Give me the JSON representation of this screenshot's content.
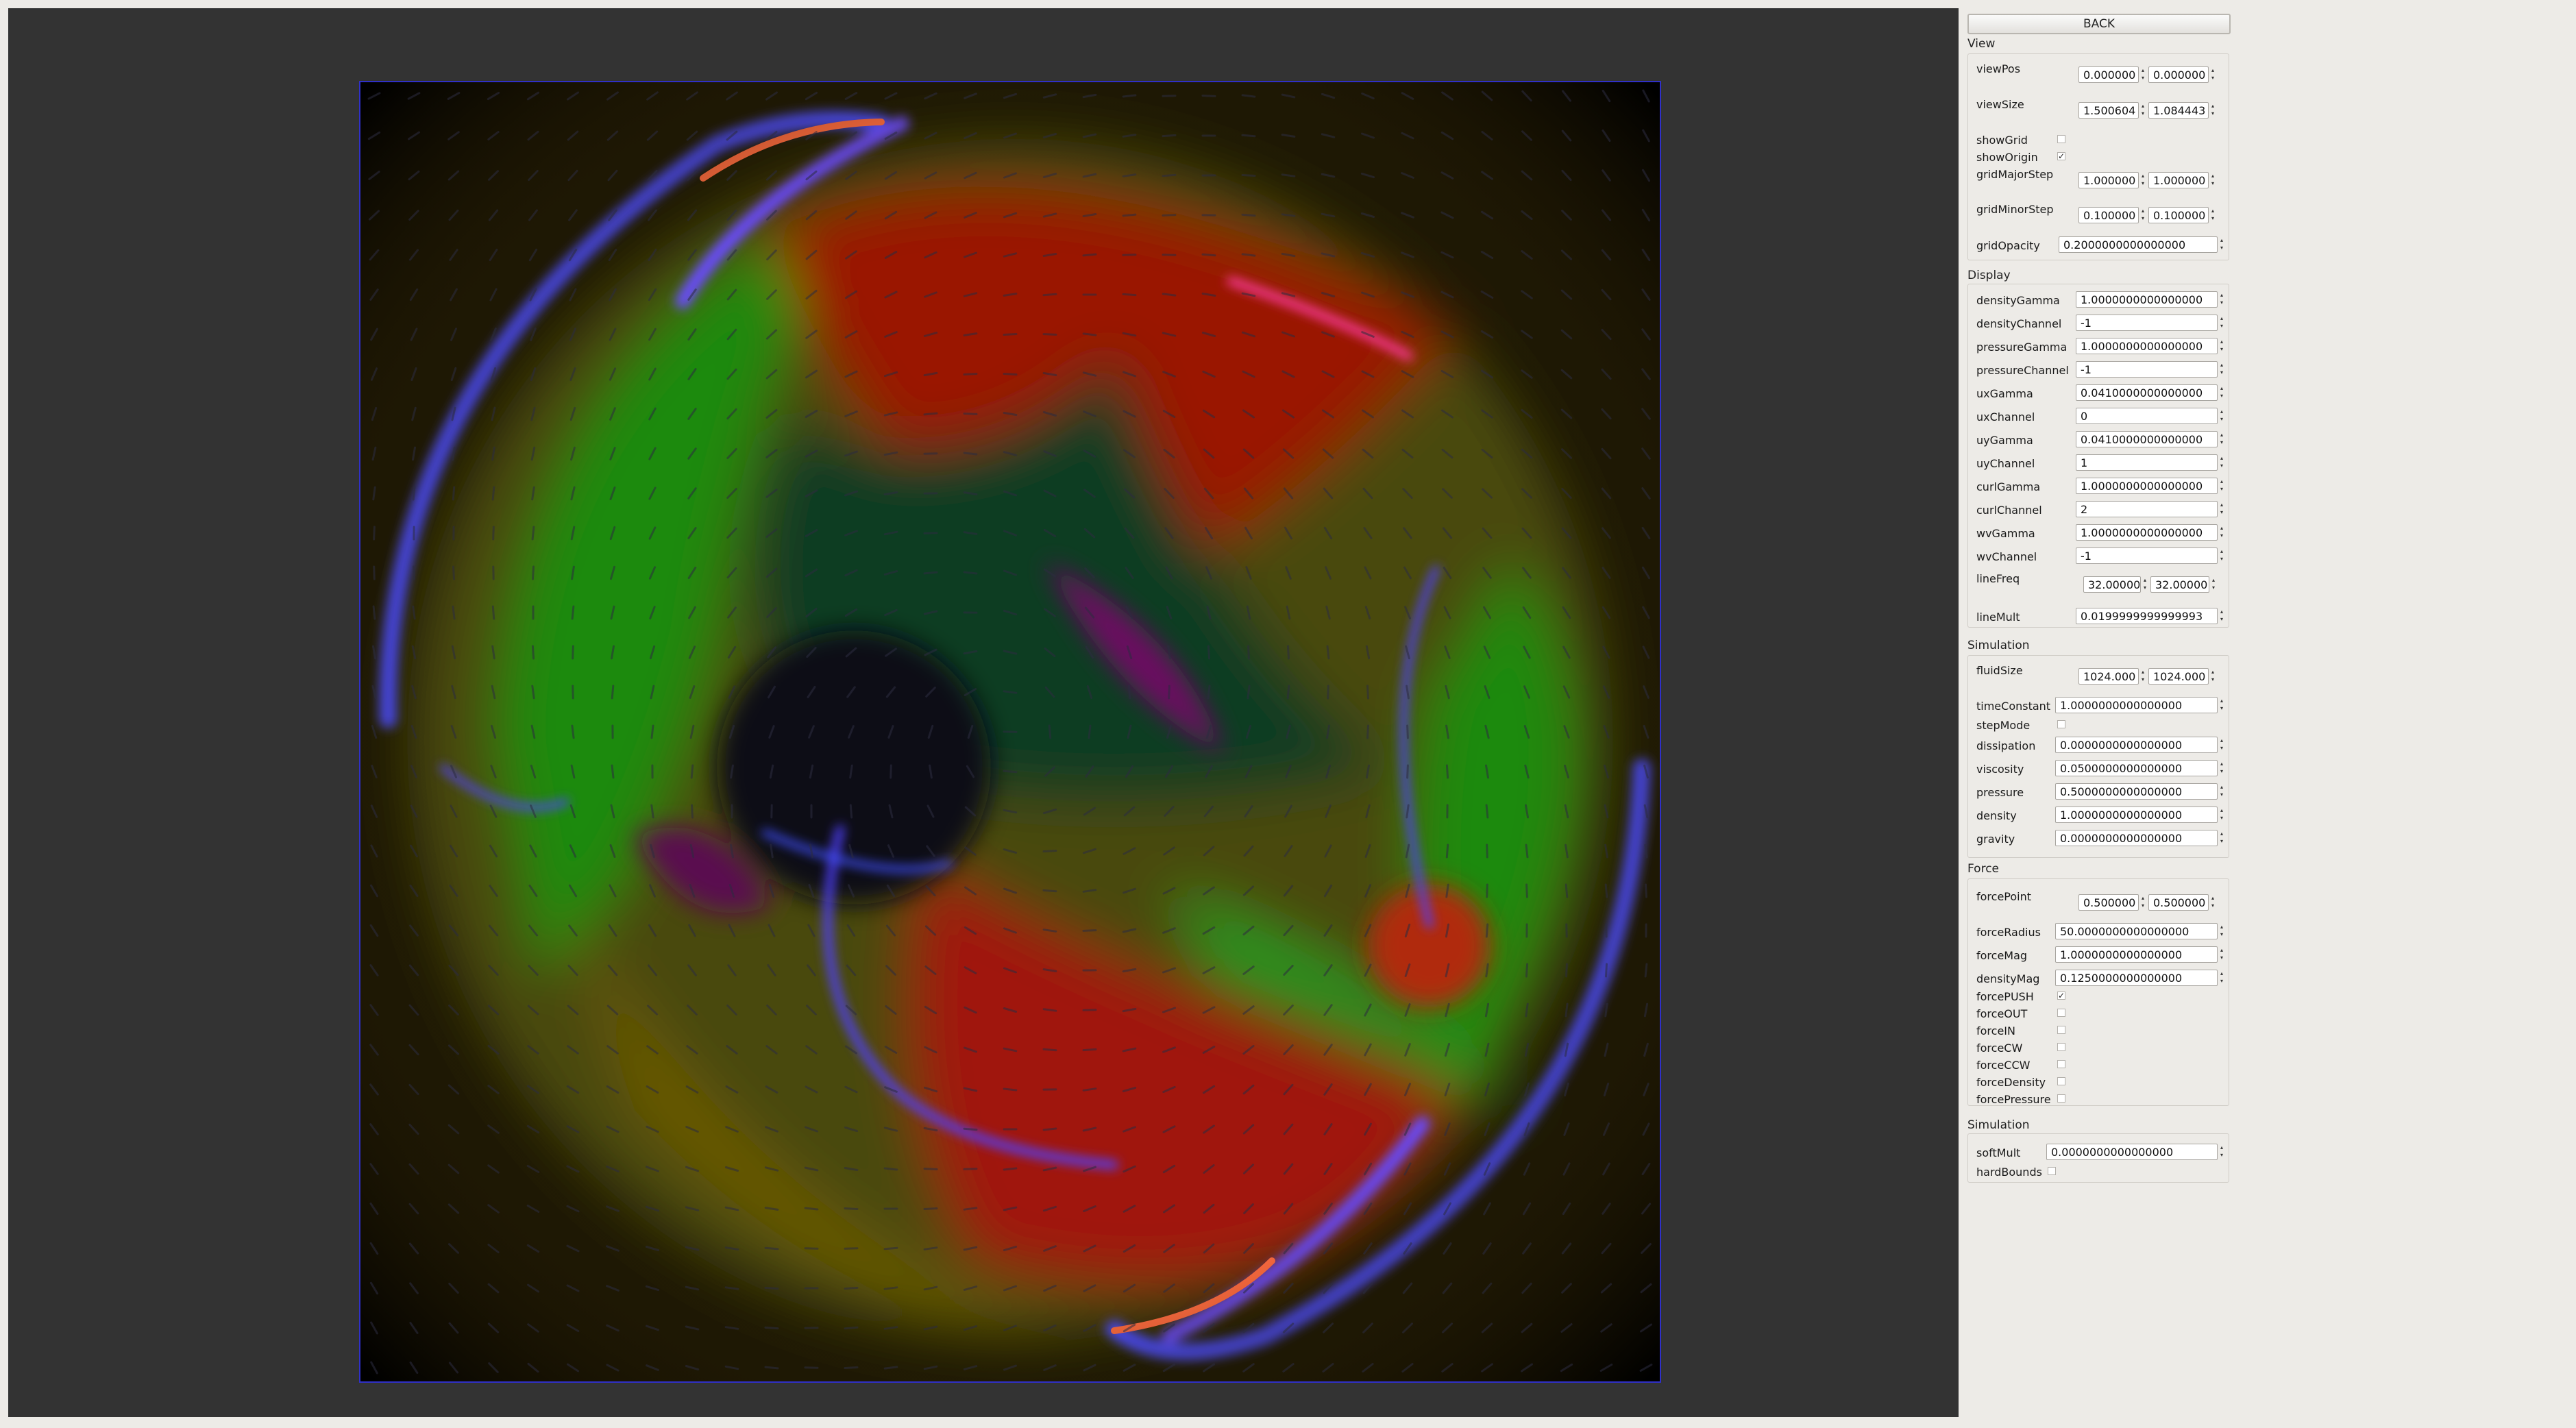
{
  "panel": {
    "back_label": "BACK",
    "sections": {
      "view": "View",
      "display": "Display",
      "simulation": "Simulation",
      "force": "Force",
      "simulation2": "Simulation"
    },
    "view": {
      "viewPos": {
        "label": "viewPos",
        "x": "0.000000",
        "y": "0.000000"
      },
      "viewSize": {
        "label": "viewSize",
        "x": "1.500604",
        "y": "1.084443"
      },
      "showGrid": {
        "label": "showGrid",
        "checked": false
      },
      "showOrigin": {
        "label": "showOrigin",
        "checked": true
      },
      "gridMajorStep": {
        "label": "gridMajorStep",
        "x": "1.000000",
        "y": "1.000000"
      },
      "gridMinorStep": {
        "label": "gridMinorStep",
        "x": "0.100000",
        "y": "0.100000"
      },
      "gridOpacity": {
        "label": "gridOpacity",
        "value": "0.2000000000000000"
      }
    },
    "display": [
      {
        "label": "densityGamma",
        "value": "1.0000000000000000"
      },
      {
        "label": "densityChannel",
        "value": "-1"
      },
      {
        "label": "pressureGamma",
        "value": "1.0000000000000000"
      },
      {
        "label": "pressureChannel",
        "value": "-1"
      },
      {
        "label": "uxGamma",
        "value": "0.0410000000000000"
      },
      {
        "label": "uxChannel",
        "value": "0"
      },
      {
        "label": "uyGamma",
        "value": "0.0410000000000000"
      },
      {
        "label": "uyChannel",
        "value": "1"
      },
      {
        "label": "curlGamma",
        "value": "1.0000000000000000"
      },
      {
        "label": "curlChannel",
        "value": "2"
      },
      {
        "label": "wvGamma",
        "value": "1.0000000000000000"
      },
      {
        "label": "wvChannel",
        "value": "-1"
      }
    ],
    "lineFreq": {
      "label": "lineFreq",
      "x": "32.00000",
      "y": "32.00000"
    },
    "lineMult": {
      "label": "lineMult",
      "value": "0.0199999999999993"
    },
    "simulation": {
      "fluidSize": {
        "label": "fluidSize",
        "x": "1024.000",
        "y": "1024.000"
      },
      "timeConstant": {
        "label": "timeConstant",
        "value": "1.0000000000000000"
      },
      "stepMode": {
        "label": "stepMode",
        "checked": false
      },
      "fields": [
        {
          "label": "dissipation",
          "value": "0.0000000000000000"
        },
        {
          "label": "viscosity",
          "value": "0.0500000000000000"
        },
        {
          "label": "pressure",
          "value": "0.5000000000000000"
        },
        {
          "label": "density",
          "value": "1.0000000000000000"
        },
        {
          "label": "gravity",
          "value": "0.0000000000000000"
        }
      ]
    },
    "force": {
      "forcePoint": {
        "label": "forcePoint",
        "x": "0.500000",
        "y": "0.500000"
      },
      "fields": [
        {
          "label": "forceRadius",
          "value": "50.0000000000000000"
        },
        {
          "label": "forceMag",
          "value": "1.0000000000000000"
        },
        {
          "label": "densityMag",
          "value": "0.1250000000000000"
        }
      ],
      "checks": [
        {
          "label": "forcePUSH",
          "checked": true
        },
        {
          "label": "forceOUT",
          "checked": false
        },
        {
          "label": "forceIN",
          "checked": false
        },
        {
          "label": "forceCW",
          "checked": false
        },
        {
          "label": "forceCCW",
          "checked": false
        },
        {
          "label": "forceDensity",
          "checked": false
        },
        {
          "label": "forcePressure",
          "checked": false
        }
      ]
    },
    "simulation2": {
      "softMult": {
        "label": "softMult",
        "value": "0.0000000000000000"
      },
      "hardBounds": {
        "label": "hardBounds",
        "checked": false
      }
    }
  },
  "colors": {
    "viewport_bg": "#333333",
    "canvas_border": "#3030c8",
    "panel_bg": "#edebe7"
  }
}
